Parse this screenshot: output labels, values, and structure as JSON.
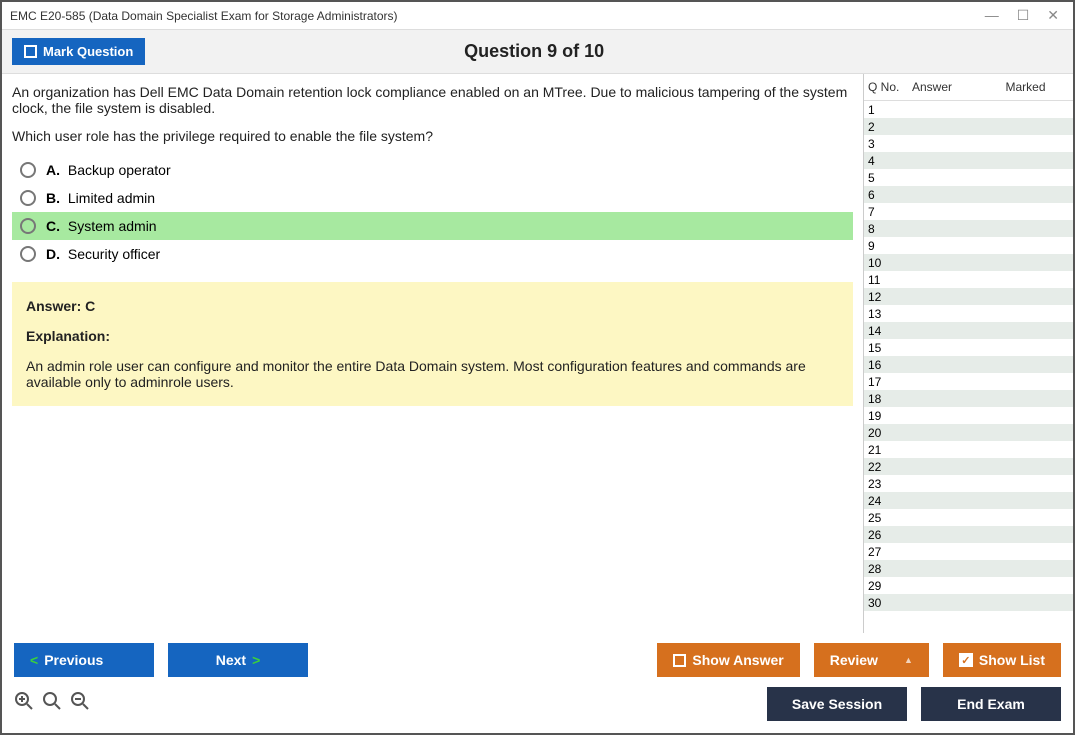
{
  "window_title": "EMC E20-585 (Data Domain Specialist Exam for Storage Administrators)",
  "topbar": {
    "mark_label": "Mark Question",
    "counter": "Question 9 of 10"
  },
  "question": {
    "para1": "An organization has Dell EMC Data Domain retention lock compliance enabled on an MTree. Due to malicious tampering of the system clock, the file system is disabled.",
    "para2": "Which user role has the privilege required to enable the file system?"
  },
  "options": [
    {
      "letter": "A.",
      "text": "Backup operator",
      "correct": false
    },
    {
      "letter": "B.",
      "text": "Limited admin",
      "correct": false
    },
    {
      "letter": "C.",
      "text": "System admin",
      "correct": true
    },
    {
      "letter": "D.",
      "text": "Security officer",
      "correct": false
    }
  ],
  "answer": {
    "label": "Answer: C",
    "exp_label": "Explanation:",
    "explanation": "An admin role user can configure and monitor the entire Data Domain system. Most configuration features and commands are available only to adminrole users."
  },
  "sidebar": {
    "head_qno": "Q No.",
    "head_answer": "Answer",
    "head_marked": "Marked",
    "row_count": 30
  },
  "buttons": {
    "previous": "Previous",
    "next": "Next",
    "show_answer": "Show Answer",
    "review": "Review",
    "show_list": "Show List",
    "save_session": "Save Session",
    "end_exam": "End Exam"
  }
}
